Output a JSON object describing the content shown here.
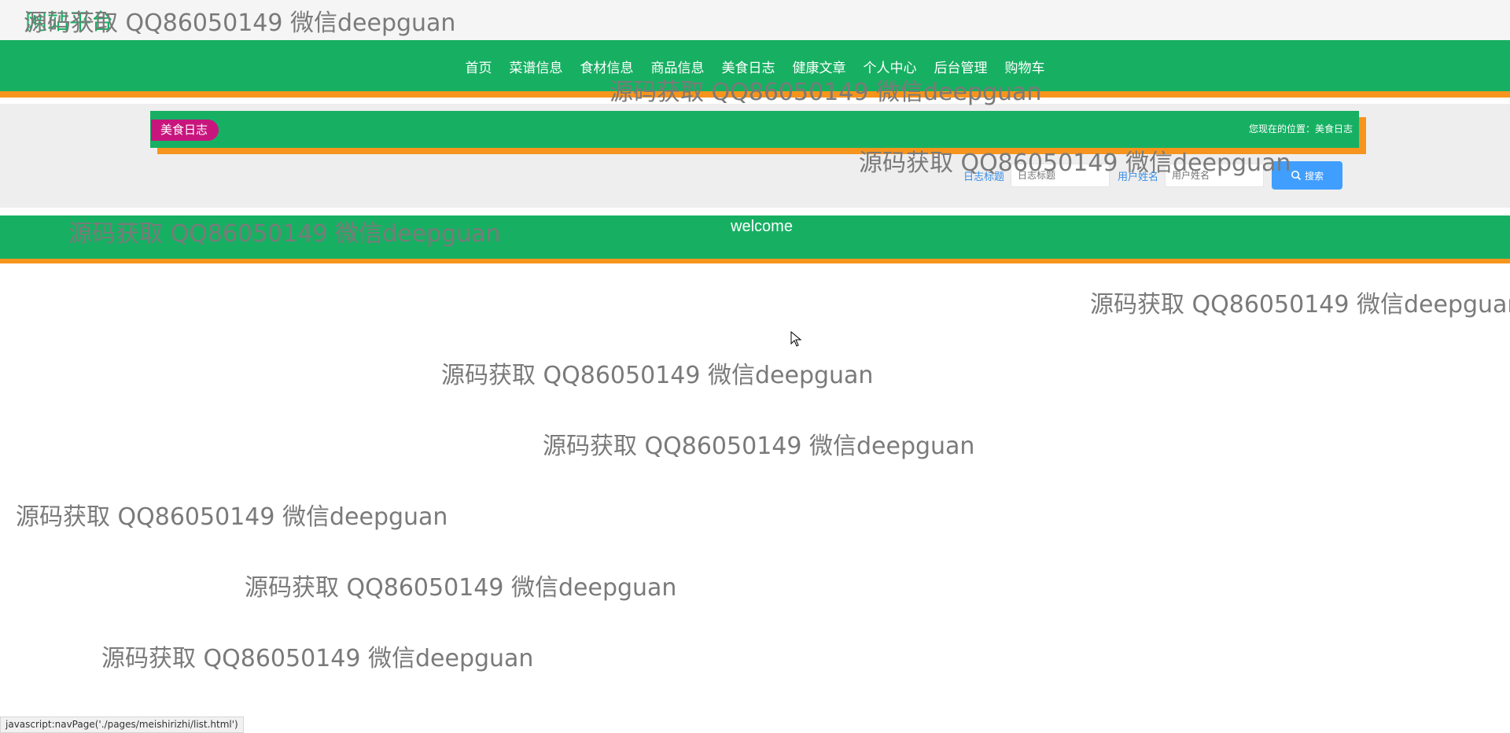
{
  "site": {
    "title": "网站平台"
  },
  "nav": {
    "items": [
      "首页",
      "菜谱信息",
      "食材信息",
      "商品信息",
      "美食日志",
      "健康文章",
      "个人中心",
      "后台管理",
      "购物车"
    ]
  },
  "breadcrumb": {
    "tag": "美食日志",
    "location": "您现在的位置：美食日志"
  },
  "search": {
    "title_label": "日志标题",
    "title_placeholder": "日志标题",
    "user_label": "用户姓名",
    "user_placeholder": "用户姓名",
    "button_label": "搜索"
  },
  "welcome": {
    "text": "welcome"
  },
  "watermark": {
    "text": "源码获取 QQ86050149 微信deepguan"
  },
  "status_bar": {
    "text": "javascript:navPage('./pages/meishirizhi/list.html')"
  },
  "colors": {
    "primary": "#17b063",
    "accent": "#f7941d",
    "tag": "#c8157d",
    "button": "#409eff"
  }
}
